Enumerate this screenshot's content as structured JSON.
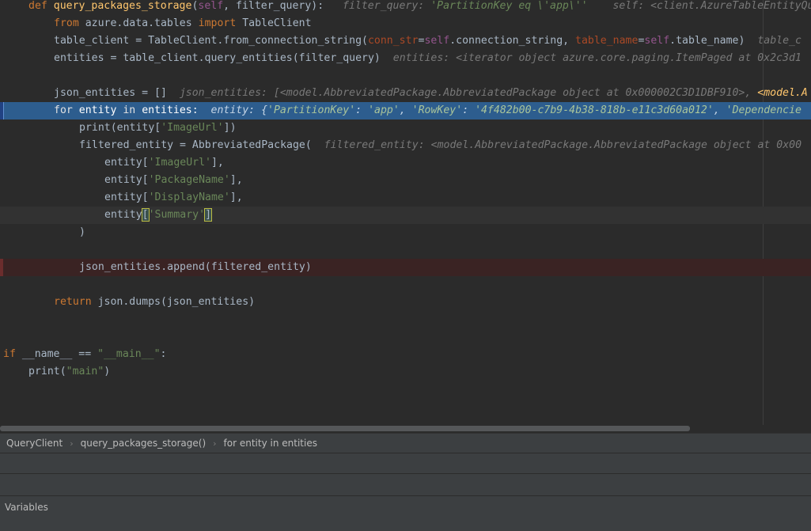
{
  "colors": {
    "editor_bg": "#2b2b2b",
    "exec_line_bg": "#2d5d8e",
    "breakpoint_bg": "#3a2323",
    "keyword": "#cc7832",
    "function": "#ffc66d",
    "string": "#6a8759",
    "self": "#94558d",
    "param": "#aa4926",
    "inline_hint": "#787878",
    "panel_bg": "#3c3f41"
  },
  "code": {
    "l1_def": "def ",
    "l1_name": "query_packages_storage",
    "l1_open": "(",
    "l1_self": "self",
    "l1_rest": ", filter_query):",
    "l1_hint_a": "filter_query: ",
    "l1_hint_str": "'PartitionKey eq \\'app\\''",
    "l1_hint_b": "self: <client.AzureTableEntityQu",
    "l2_from": "from",
    "l2_mod": " azure.data.tables ",
    "l2_import": "import",
    "l2_rest": " TableClient",
    "l3_a": "table_client = TableClient.from_connection_string(",
    "l3_p1": "conn_str",
    "l3_b": "=",
    "l3_self1": "self",
    "l3_c": ".connection_string, ",
    "l3_p2": "table_name",
    "l3_d": "=",
    "l3_self2": "self",
    "l3_e": ".table_name)",
    "l3_hint": "table_c",
    "l4_a": "entities = table_client.query_entities(filter_query)",
    "l4_hint": "entities: <iterator object azure.core.paging.ItemPaged at 0x2c3d1",
    "l6_a": "json_entities = []",
    "l6_hint": "json_entities: [<model.AbbreviatedPackage.AbbreviatedPackage object at 0x000002C3D1DBF910>, ",
    "l6_hint_warn": "<model.A",
    "l7_for": "for",
    "l7_a": " entity ",
    "l7_in": "in",
    "l7_b": " entities:",
    "l7_hint_a": "entity: {",
    "l7_hint_s1": "'PartitionKey'",
    "l7_hint_b": ": ",
    "l7_hint_s2": "'app'",
    "l7_hint_c": ", ",
    "l7_hint_s3": "'RowKey'",
    "l7_hint_d": ": ",
    "l7_hint_s4": "'4f482b00-c7b9-4b38-818b-e11c3d60a012'",
    "l7_hint_e": ", ",
    "l7_hint_s5": "'Dependencie",
    "l8_a": "print(entity[",
    "l8_str": "'ImageUrl'",
    "l8_b": "])",
    "l9_a": "filtered_entity = AbbreviatedPackage(",
    "l9_hint": "filtered_entity: <model.AbbreviatedPackage.AbbreviatedPackage object at 0x00",
    "l10_a": "entity[",
    "l10_str": "'ImageUrl'",
    "l10_b": "],",
    "l11_a": "entity[",
    "l11_str": "'PackageName'",
    "l11_b": "],",
    "l12_a": "entity[",
    "l12_str": "'DisplayName'",
    "l12_b": "],",
    "l13_a": "entity",
    "l13_open": "[",
    "l13_str": "'Summary'",
    "l13_close": "]",
    "l14_a": ")",
    "l16_a": "json_entities.append(filtered_entity)",
    "l18_return": "return",
    "l18_a": " json.dumps(json_entities)",
    "l21_if": "if",
    "l21_a": " __name__ == ",
    "l21_str": "\"__main__\"",
    "l21_b": ":",
    "l22_a": "print(",
    "l22_str": "\"main\"",
    "l22_b": ")"
  },
  "breadcrumb": {
    "items": [
      "QueryClient",
      "query_packages_storage()",
      "for entity in entities"
    ],
    "separator": "›"
  },
  "debug_panel": {
    "variables_label": "Variables"
  }
}
